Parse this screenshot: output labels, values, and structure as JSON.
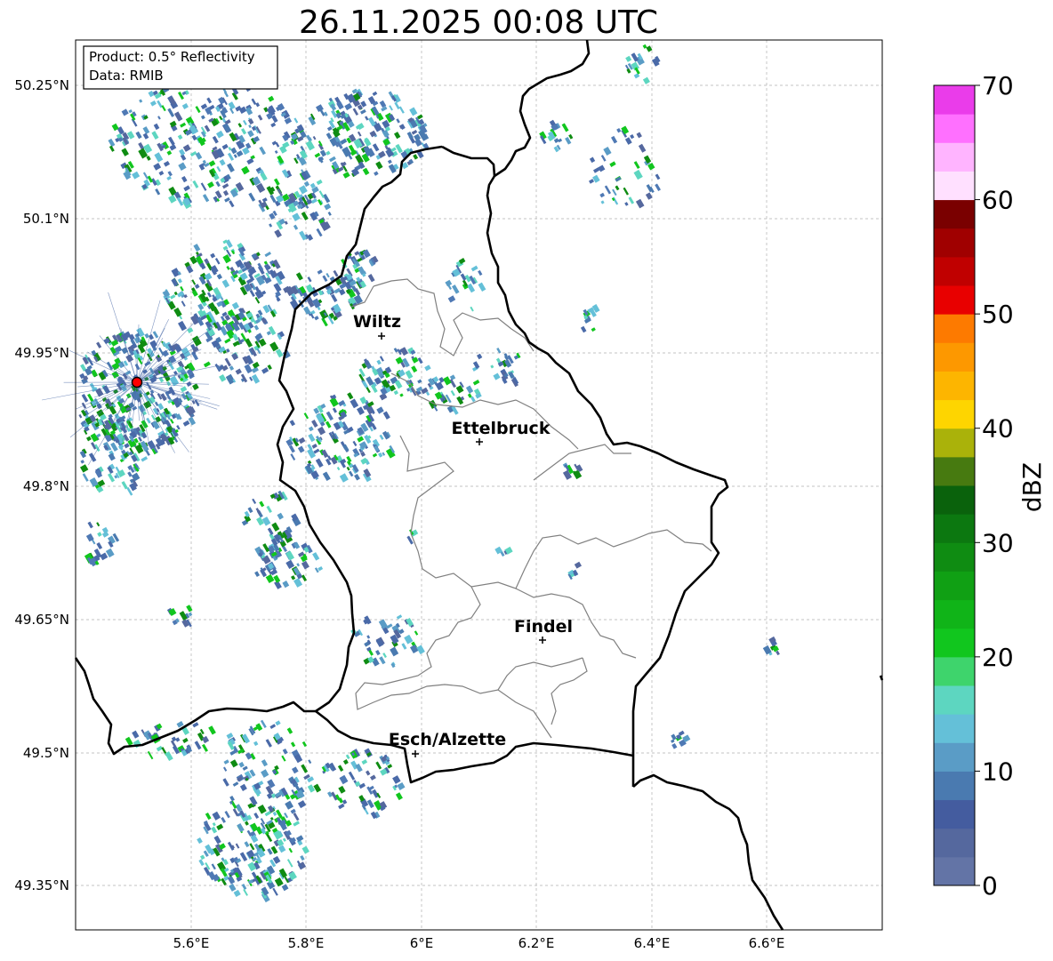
{
  "title": "26.11.2025 00:08 UTC",
  "info_box": {
    "product": "Product: 0.5° Reflectivity",
    "data": "Data: RMIB"
  },
  "lat_labels": [
    "50.25°N",
    "50.1°N",
    "49.95°N",
    "49.8°N",
    "49.65°N",
    "49.5°N",
    "49.35°N"
  ],
  "lon_labels": [
    "5.6°E",
    "5.8°E",
    "6°E",
    "6.2°E",
    "6.4°E",
    "6.6°E"
  ],
  "cities": [
    {
      "name": "Wiltz"
    },
    {
      "name": "Ettelbruck"
    },
    {
      "name": "Findel"
    },
    {
      "name": "Esch/Alzette"
    }
  ],
  "colorbar": {
    "label": "dBZ",
    "ticks": [
      "0",
      "10",
      "20",
      "30",
      "40",
      "50",
      "60",
      "70"
    ],
    "colors": [
      "#6374a6",
      "#55689e",
      "#445c9f",
      "#4a7ab0",
      "#5a9cc6",
      "#64c0d8",
      "#5dd6c0",
      "#3ed46c",
      "#11c61e",
      "#10b418",
      "#10a014",
      "#0f8c12",
      "#0c7810",
      "#0a620c",
      "#477a10",
      "#aab20a",
      "#fed500",
      "#fdb500",
      "#fd9800",
      "#fd7a00",
      "#e80000",
      "#c00000",
      "#a00000",
      "#7a0000",
      "#ffe0ff",
      "#ffb4ff",
      "#ff70ff",
      "#ea3cea"
    ]
  },
  "radar_site_color": "#ff0000"
}
